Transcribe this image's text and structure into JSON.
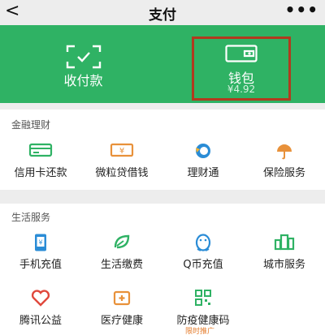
{
  "nav": {
    "back_glyph": "<",
    "title": "支付",
    "more_glyph": "•••"
  },
  "hero": {
    "pay": {
      "label": "收付款",
      "icon": "scan-icon"
    },
    "wallet": {
      "label": "钱包",
      "balance": "¥4.92",
      "icon": "wallet-icon"
    }
  },
  "finance": {
    "title": "金融理财",
    "items": [
      {
        "label": "信用卡还款",
        "icon": "credit-card-icon"
      },
      {
        "label": "微粒贷借钱",
        "icon": "cash-icon"
      },
      {
        "label": "理财通",
        "icon": "wealth-icon"
      },
      {
        "label": "保险服务",
        "icon": "umbrella-icon"
      }
    ]
  },
  "life": {
    "title": "生活服务",
    "items": [
      {
        "label": "手机充值",
        "icon": "phone-icon"
      },
      {
        "label": "生活缴费",
        "icon": "leaf-icon"
      },
      {
        "label": "Q币充值",
        "icon": "penguin-icon"
      },
      {
        "label": "城市服务",
        "icon": "city-icon"
      },
      {
        "label": "腾讯公益",
        "icon": "heart-icon"
      },
      {
        "label": "医疗健康",
        "icon": "medical-icon"
      },
      {
        "label": "防疫健康码",
        "icon": "qr-icon"
      }
    ]
  },
  "promo": "限时推广",
  "colors": {
    "green": "#2fb264",
    "highlight": "#b13a1e",
    "orange": "#e8913a",
    "blue": "#2a8cd6",
    "red": "#e0483c"
  }
}
